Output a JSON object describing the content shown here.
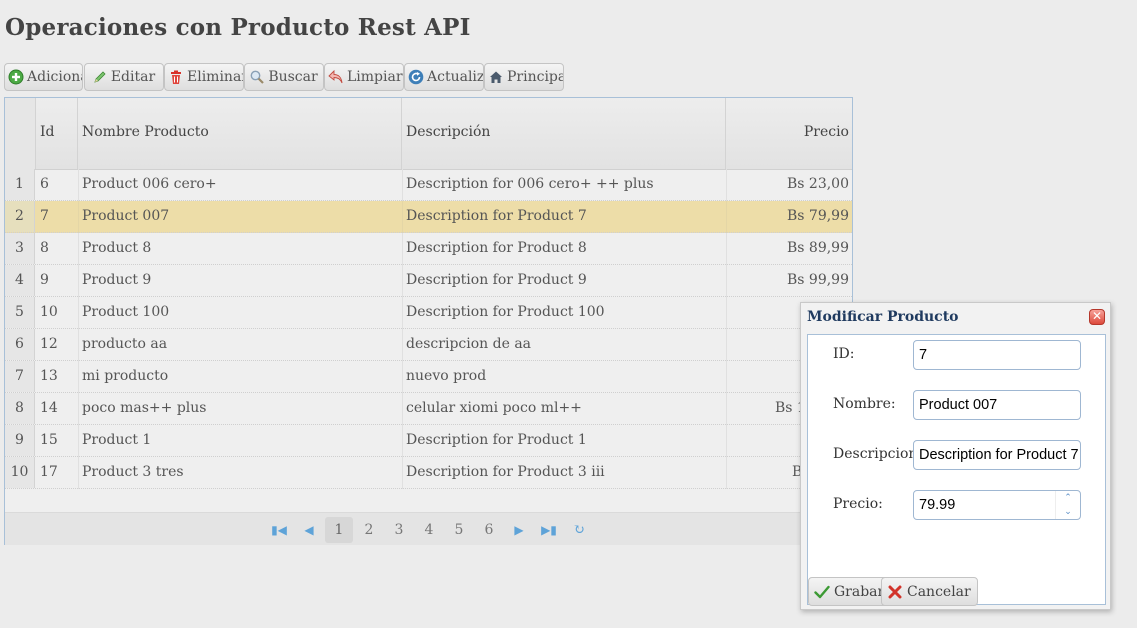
{
  "page": {
    "title": "Operaciones con Producto Rest API"
  },
  "toolbar": {
    "buttons": [
      {
        "label": "Adicionar",
        "icon": "add-icon"
      },
      {
        "label": "Editar",
        "icon": "pencil-icon"
      },
      {
        "label": "Eliminar",
        "icon": "trash-icon"
      },
      {
        "label": "Buscar",
        "icon": "search-icon"
      },
      {
        "label": "Limpiar",
        "icon": "undo-icon"
      },
      {
        "label": "Actualizar",
        "icon": "refresh-icon"
      },
      {
        "label": "Principal",
        "icon": "home-icon"
      }
    ]
  },
  "grid": {
    "headers": {
      "id": "Id",
      "name": "Nombre Producto",
      "desc": "Descripción",
      "price": "Precio"
    },
    "rows": [
      {
        "n": "1",
        "id": "6",
        "name": "Product 006 cero+",
        "desc": "Description for 006 cero+ ++ plus",
        "price": "Bs 23,00"
      },
      {
        "n": "2",
        "id": "7",
        "name": "Product 007",
        "desc": "Description for Product 7",
        "price": "Bs 79,99"
      },
      {
        "n": "3",
        "id": "8",
        "name": "Product 8",
        "desc": "Description for Product 8",
        "price": "Bs 89,99"
      },
      {
        "n": "4",
        "id": "9",
        "name": "Product 9",
        "desc": "Description for Product 9",
        "price": "Bs 99,99"
      },
      {
        "n": "5",
        "id": "10",
        "name": "Product 100",
        "desc": "Description for Product 100",
        "price": ""
      },
      {
        "n": "6",
        "id": "12",
        "name": "producto aa",
        "desc": "descripcion de aa",
        "price": ""
      },
      {
        "n": "7",
        "id": "13",
        "name": "mi producto",
        "desc": "nuevo prod",
        "price": ""
      },
      {
        "n": "8",
        "id": "14",
        "name": "poco mas++ plus",
        "desc": "celular xiomi poco ml++",
        "price": "Bs 1("
      },
      {
        "n": "9",
        "id": "15",
        "name": "Product 1",
        "desc": "Description for Product 1",
        "price": ""
      },
      {
        "n": "10",
        "id": "17",
        "name": "Product 3 tres",
        "desc": "Description for Product 3 iii",
        "price": "B"
      }
    ],
    "selected_row": 1,
    "pagination": {
      "pages": [
        "1",
        "2",
        "3",
        "4",
        "5",
        "6"
      ],
      "current": "1"
    }
  },
  "dialog": {
    "title": "Modificar Producto",
    "fields": {
      "id": {
        "label": "ID:",
        "value": "7"
      },
      "nombre": {
        "label": "Nombre:",
        "value": "Product 007"
      },
      "descripcion": {
        "label": "Descripcion:",
        "value": "Description for Product 7"
      },
      "precio": {
        "label": "Precio:",
        "value": "79.99"
      }
    },
    "buttons": {
      "save": "Grabar",
      "cancel": "Cancelar"
    }
  },
  "colors": {
    "selected_row": "#eddda8",
    "grid_border": "#a8c0d8",
    "pager_icon": "#5ea3d8",
    "dialog_title": "#1f3a5f"
  }
}
